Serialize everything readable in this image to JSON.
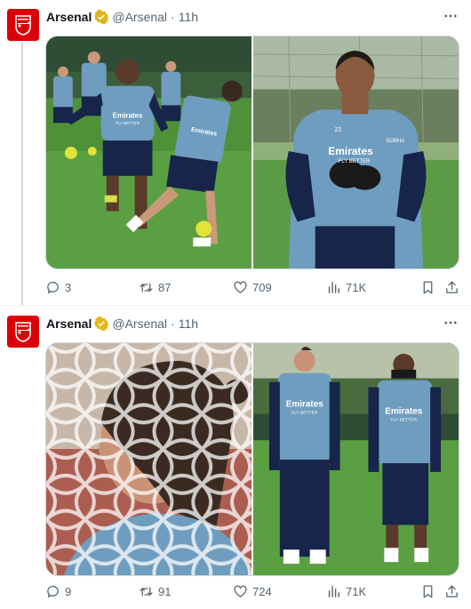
{
  "tweets": [
    {
      "author": {
        "name": "Arsenal",
        "handle": "@Arsenal",
        "time": "11h"
      },
      "stats": {
        "replies": "3",
        "reposts": "87",
        "likes": "709",
        "views": "71K"
      },
      "photos": [
        {
          "jersey_text": "Emirates",
          "jersey_sub": "FLY BETTER"
        },
        {
          "jersey_text": "Emirates",
          "jersey_sub": "FLY BETTER",
          "number": "22",
          "sleeve": "SOBHA"
        }
      ]
    },
    {
      "author": {
        "name": "Arsenal",
        "handle": "@Arsenal",
        "time": "11h"
      },
      "stats": {
        "replies": "9",
        "reposts": "91",
        "likes": "724",
        "views": "71K"
      },
      "photos": [
        {},
        {
          "jersey_text": "Emirates",
          "jersey_sub": "FLY BETTER"
        }
      ]
    }
  ],
  "colors": {
    "brand_red": "#db0007",
    "verified_gold": "#e2b719",
    "jersey_blue": "#6f9dbf",
    "navy": "#17254a",
    "grass": "#4e9a3a"
  },
  "icons": [
    "arsenal-crest-icon",
    "verified-badge-icon",
    "more-icon",
    "reply-icon",
    "retweet-icon",
    "like-icon",
    "views-icon",
    "bookmark-icon",
    "share-icon"
  ]
}
